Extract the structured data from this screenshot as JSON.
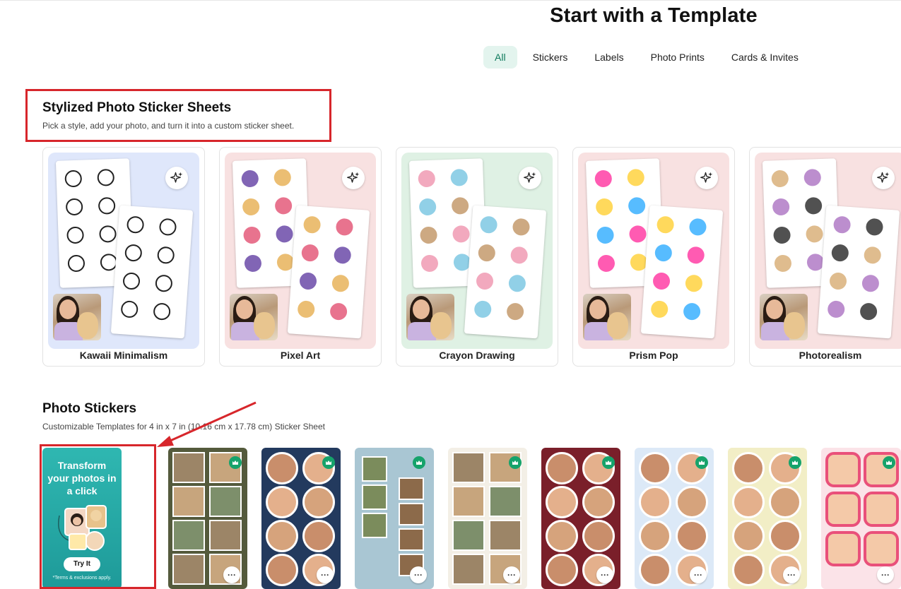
{
  "header": {
    "title": "Start with a Template"
  },
  "tabs": [
    {
      "label": "All",
      "active": true
    },
    {
      "label": "Stickers",
      "active": false
    },
    {
      "label": "Labels",
      "active": false
    },
    {
      "label": "Photo Prints",
      "active": false
    },
    {
      "label": "Cards & Invites",
      "active": false
    }
  ],
  "stylized_section": {
    "title": "Stylized Photo Sticker Sheets",
    "subtitle": "Pick a style, add your photo, and turn it into a custom sticker sheet.",
    "cards": [
      {
        "label": "Kawaii Minimalism",
        "bg": "#dfe7fb"
      },
      {
        "label": "Pixel Art",
        "bg": "#f8e1e1"
      },
      {
        "label": "Crayon Drawing",
        "bg": "#dff1e4"
      },
      {
        "label": "Prism Pop",
        "bg": "#f8e1e1"
      },
      {
        "label": "Photorealism",
        "bg": "#f8e1e1"
      }
    ]
  },
  "photo_stickers": {
    "title": "Photo Stickers",
    "subtitle": "Customizable Templates for 4 in x 7 in (10.16 cm x 17.78 cm) Sticker Sheet",
    "promo": {
      "headline": "Transform your photos in a click",
      "button": "Try It",
      "terms": "*Terms & exclusions apply."
    },
    "more_glyph": "···",
    "templates": [
      {
        "name": "polaroid-green",
        "bg": "#545a3c"
      },
      {
        "name": "circle-navy-check",
        "bg": "#233a5e"
      },
      {
        "name": "filmstrip-blue",
        "bg": "#a9c6d3"
      },
      {
        "name": "square-frames-cream",
        "bg": "#f3efe6"
      },
      {
        "name": "circle-maroon",
        "bg": "#7a1f2a"
      },
      {
        "name": "animal-hats-blue",
        "bg": "#dce9f7"
      },
      {
        "name": "circle-squiggle-yellow",
        "bg": "#f2eec6"
      },
      {
        "name": "wavy-frame-pink",
        "bg": "#fbe3e8"
      }
    ]
  },
  "colors": {
    "accent": "#16a36b",
    "highlight": "#d7262b",
    "active_tab_bg": "#e3f4ee"
  }
}
